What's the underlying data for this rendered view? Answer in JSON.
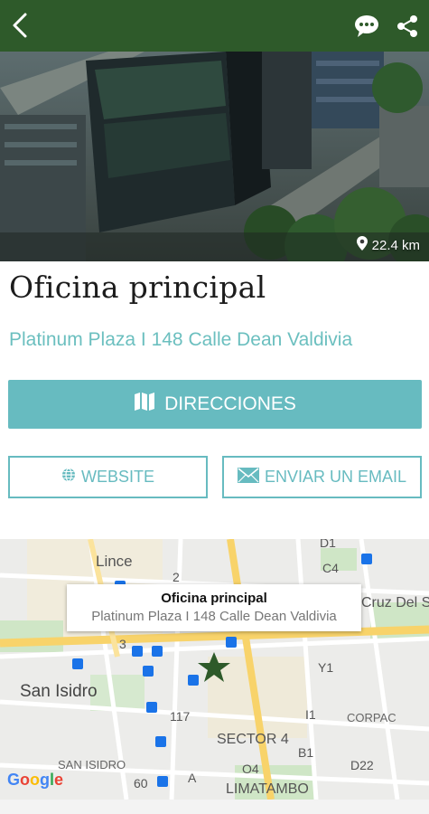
{
  "colors": {
    "header": "#2e5a2a",
    "accent": "#67bbc0",
    "address": "#6bbfbf",
    "marker": "#2e5a2a"
  },
  "header": {
    "back_icon": "chevron-left-icon",
    "chat_icon": "chat-bubble-icon",
    "share_icon": "share-icon"
  },
  "hero": {
    "distance": "22.4 km",
    "distance_icon": "location-pin-icon"
  },
  "place": {
    "title": "Oficina principal",
    "address": "Platinum Plaza I 148 Calle Dean Valdivia"
  },
  "actions": {
    "directions_label": "DIRECCIONES",
    "directions_icon": "map-icon",
    "website_label": "WEBSITE",
    "website_icon": "globe-icon",
    "email_label": "ENVIAR UN EMAIL",
    "email_icon": "envelope-icon"
  },
  "map": {
    "callout_title": "Oficina principal",
    "callout_address": "Platinum Plaza I 148 Calle Dean Valdivia",
    "marker_icon": "star-marker-icon",
    "labels": {
      "lince": "Lince",
      "san_isidro": "San Isidro",
      "cruz_del_sur": "Cruz Del Su",
      "corpac": "CORPAC",
      "sector4": "SECTOR 4",
      "san_isidro_small": "SAN ISIDRO",
      "limatambo": "LIMATAMBO",
      "d1": "D1",
      "c4": "C4",
      "n2": "2",
      "n3": "3",
      "y1": "Y1",
      "n117": "117",
      "i1": "I1",
      "b1": "B1",
      "o4": "O4",
      "d22": "D22",
      "n60": "60",
      "a": "A"
    },
    "google": "Google"
  }
}
